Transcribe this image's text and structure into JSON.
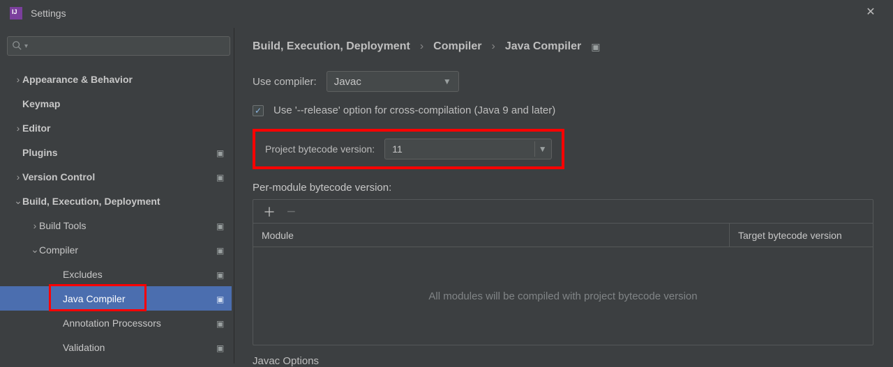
{
  "window": {
    "title": "Settings"
  },
  "search": {
    "placeholder": ""
  },
  "tree": {
    "items": [
      {
        "label": "Appearance & Behavior",
        "indent": 0,
        "arrow": "right",
        "bold": true,
        "badge": false
      },
      {
        "label": "Keymap",
        "indent": 0,
        "arrow": "none",
        "bold": true,
        "badge": false
      },
      {
        "label": "Editor",
        "indent": 0,
        "arrow": "right",
        "bold": true,
        "badge": false
      },
      {
        "label": "Plugins",
        "indent": 0,
        "arrow": "none",
        "bold": true,
        "badge": true
      },
      {
        "label": "Version Control",
        "indent": 0,
        "arrow": "right",
        "bold": true,
        "badge": true
      },
      {
        "label": "Build, Execution, Deployment",
        "indent": 0,
        "arrow": "down",
        "bold": true,
        "badge": false
      },
      {
        "label": "Build Tools",
        "indent": 1,
        "arrow": "right",
        "bold": false,
        "badge": true
      },
      {
        "label": "Compiler",
        "indent": 1,
        "arrow": "down",
        "bold": false,
        "badge": true
      },
      {
        "label": "Excludes",
        "indent": 2,
        "arrow": "none",
        "bold": false,
        "badge": true
      },
      {
        "label": "Java Compiler",
        "indent": 2,
        "arrow": "none",
        "bold": false,
        "badge": true,
        "selected": true
      },
      {
        "label": "Annotation Processors",
        "indent": 2,
        "arrow": "none",
        "bold": false,
        "badge": true
      },
      {
        "label": "Validation",
        "indent": 2,
        "arrow": "none",
        "bold": false,
        "badge": true
      }
    ]
  },
  "breadcrumb": {
    "a": "Build, Execution, Deployment",
    "b": "Compiler",
    "c": "Java Compiler"
  },
  "form": {
    "use_compiler_label": "Use compiler:",
    "use_compiler_value": "Javac",
    "release_option": "Use '--release' option for cross-compilation (Java 9 and later)",
    "project_bytecode_label": "Project bytecode version:",
    "project_bytecode_value": "11",
    "per_module_label": "Per-module bytecode version:",
    "module_col": "Module",
    "target_col": "Target bytecode version",
    "empty_msg": "All modules will be compiled with project bytecode version",
    "javac_options": "Javac Options"
  }
}
